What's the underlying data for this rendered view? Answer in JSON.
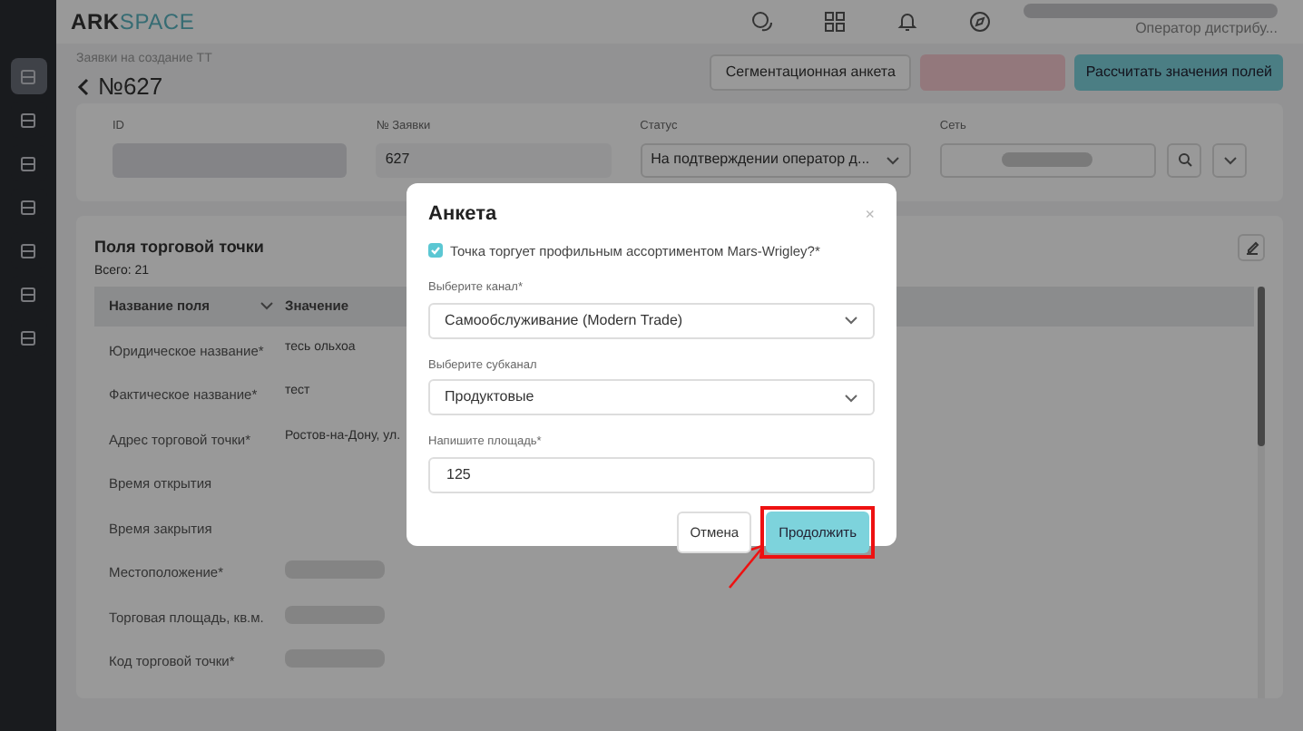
{
  "app": {
    "logo_bold": "ARK",
    "logo_light": "SPACE",
    "role": "Оператор дистрибу..."
  },
  "sidebar": {
    "items": [
      {
        "selected": true
      },
      {
        "selected": false
      },
      {
        "selected": false
      },
      {
        "selected": false
      },
      {
        "selected": false
      },
      {
        "selected": false
      },
      {
        "selected": false
      }
    ]
  },
  "breadcrumb": "Заявки на создание ТТ",
  "title": "№627",
  "actions": [
    {
      "kind": "default",
      "label": "Сегментационная анкета"
    },
    {
      "kind": "redacted"
    },
    {
      "kind": "primary",
      "label": "Рассчитать значения полей"
    }
  ],
  "fields": [
    {
      "label": "ID",
      "kind": "redacted"
    },
    {
      "label": "№ Заявки",
      "kind": "text",
      "value": "627"
    },
    {
      "label": "Статус",
      "kind": "select",
      "value": "На подтверждении оператор д..."
    },
    {
      "label": "Сеть",
      "kind": "network"
    }
  ],
  "card": {
    "title": "Поля торговой точки",
    "total": "Всего: 21",
    "columns": [
      "Название поля",
      "Значение"
    ],
    "rows": [
      {
        "name": "Юридическое название*",
        "value": "тесь ольхоа"
      },
      {
        "name": "Фактическое название*",
        "value": "тест"
      },
      {
        "name": "Адрес торговой точки*",
        "value": "Ростов-на-Дону, ул."
      },
      {
        "name": "Время открытия"
      },
      {
        "name": "Время закрытия"
      },
      {
        "name": "Местоположение*",
        "redacted": true
      },
      {
        "name": "Торговая площадь, кв.м.",
        "redacted": true
      },
      {
        "name": "Код торговой точки*",
        "redacted": true
      }
    ]
  },
  "modal": {
    "title": "Анкета",
    "close": "×",
    "checkbox": {
      "label": "Точка торгует профильным ассортиментом Mars-Wrigley?*",
      "checked": true
    },
    "fields": [
      {
        "label": "Выберите канал*",
        "kind": "select",
        "value": "Самообслуживание (Modern Trade)"
      },
      {
        "label": "Выберите субканал",
        "kind": "select",
        "value": "Продуктовые"
      },
      {
        "label": "Напишите площадь*",
        "kind": "input",
        "value": "125"
      }
    ],
    "buttons": [
      {
        "kind": "secondary",
        "label": "Отмена",
        "highlighted": false
      },
      {
        "kind": "primary",
        "label": "Продолжить",
        "highlighted": true
      }
    ]
  }
}
